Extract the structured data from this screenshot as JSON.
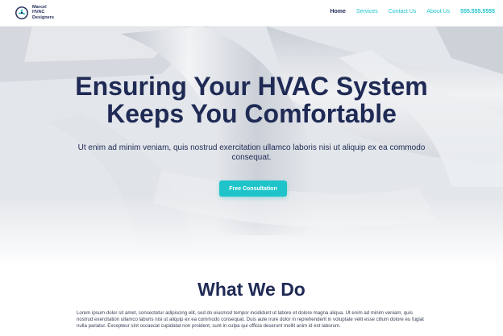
{
  "brand": {
    "name_line1": "Marcel HVAC",
    "name_line2": "Designers"
  },
  "nav": {
    "items": [
      {
        "label": "Home"
      },
      {
        "label": "Services"
      },
      {
        "label": "Contact Us"
      },
      {
        "label": "About Us"
      },
      {
        "label": "555.555.5555"
      }
    ]
  },
  "hero": {
    "title_line1": "Ensuring Your HVAC System",
    "title_line2": "Keeps You Comfortable",
    "subtitle": "Ut enim ad minim veniam, quis nostrud exercitation ullamco laboris nisi ut aliquip ex ea commodo consequat.",
    "cta_label": "Free Consultation"
  },
  "section": {
    "title": "What We Do",
    "body": "Lorem ipsum dolor sit amet, consectetur adipiscing elit, sed do eiusmod tempor incididunt ut labore et dolore magna aliqua. Ut enim ad minim veniam, quis nostrud exercitation ullamco laboris nisi ut aliquip ex ea commodo consequat. Duis aute irure dolor in reprehenderit in voluptate velit esse cillum dolore eu fugiat nulla pariatur. Excepteur sint occaecat cupidatat non proident, sunt in culpa qui officia deserunt mollit anim id est laborum."
  },
  "colors": {
    "accent": "#1ec4c9",
    "navy": "#1f2a55",
    "body_text": "#3b4257"
  },
  "icons": {
    "logo": "fan-icon"
  }
}
